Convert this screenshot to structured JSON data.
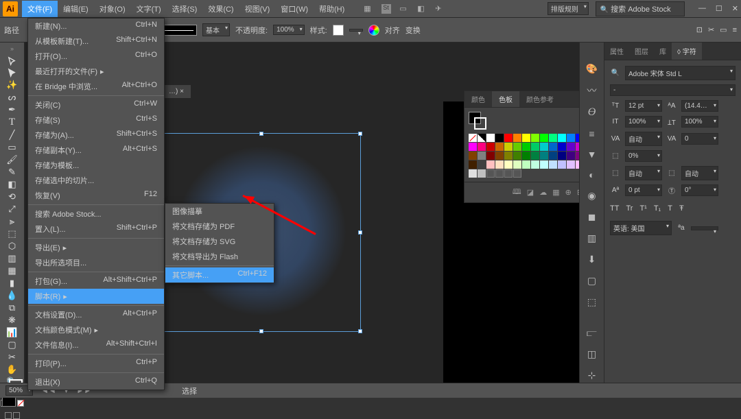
{
  "app": {
    "logo": "Ai"
  },
  "menubar": [
    "文件(F)",
    "编辑(E)",
    "对象(O)",
    "文字(T)",
    "选择(S)",
    "效果(C)",
    "视图(V)",
    "窗口(W)",
    "帮助(H)"
  ],
  "top_right": {
    "layout_label": "排版规则",
    "search_placeholder": "搜索 Adobe Stock"
  },
  "control_bar": {
    "stroke_style": "基本",
    "opacity_label": "不透明度:",
    "opacity_value": "100%",
    "style_label": "样式:",
    "align_label": "对齐",
    "transform_label": "变换"
  },
  "doc_tab": "…)   ×",
  "file_menu": [
    {
      "label": "新建(N)...",
      "shortcut": "Ctrl+N"
    },
    {
      "label": "从模板新建(T)...",
      "shortcut": "Shift+Ctrl+N"
    },
    {
      "label": "打开(O)...",
      "shortcut": "Ctrl+O"
    },
    {
      "label": "最近打开的文件(F)",
      "shortcut": "",
      "sub": true
    },
    {
      "label": "在 Bridge 中浏览...",
      "shortcut": "Alt+Ctrl+O"
    },
    {
      "sep": true
    },
    {
      "label": "关闭(C)",
      "shortcut": "Ctrl+W"
    },
    {
      "label": "存储(S)",
      "shortcut": "Ctrl+S"
    },
    {
      "label": "存储为(A)...",
      "shortcut": "Shift+Ctrl+S"
    },
    {
      "label": "存储副本(Y)...",
      "shortcut": "Alt+Ctrl+S"
    },
    {
      "label": "存储为模板...",
      "shortcut": ""
    },
    {
      "label": "存储选中的切片...",
      "shortcut": ""
    },
    {
      "label": "恢复(V)",
      "shortcut": "F12"
    },
    {
      "sep": true
    },
    {
      "label": "搜索 Adobe Stock...",
      "shortcut": ""
    },
    {
      "label": "置入(L)...",
      "shortcut": "Shift+Ctrl+P"
    },
    {
      "sep": true
    },
    {
      "label": "导出(E)",
      "shortcut": "",
      "sub": true
    },
    {
      "label": "导出所选项目...",
      "shortcut": ""
    },
    {
      "sep": true
    },
    {
      "label": "打包(G)...",
      "shortcut": "Alt+Shift+Ctrl+P"
    },
    {
      "label": "脚本(R)",
      "shortcut": "",
      "sub": true,
      "hl": true
    },
    {
      "sep": true
    },
    {
      "label": "文档设置(D)...",
      "shortcut": "Alt+Ctrl+P"
    },
    {
      "label": "文档颜色模式(M)",
      "shortcut": "",
      "sub": true
    },
    {
      "label": "文件信息(I)...",
      "shortcut": "Alt+Shift+Ctrl+I"
    },
    {
      "sep": true
    },
    {
      "label": "打印(P)...",
      "shortcut": "Ctrl+P"
    },
    {
      "sep": true
    },
    {
      "label": "退出(X)",
      "shortcut": "Ctrl+Q"
    }
  ],
  "script_submenu": [
    {
      "label": "图像描摹",
      "shortcut": ""
    },
    {
      "label": "将文档存储为 PDF",
      "shortcut": ""
    },
    {
      "label": "将文档存储为 SVG",
      "shortcut": ""
    },
    {
      "label": "将文档导出为 Flash",
      "shortcut": ""
    },
    {
      "sep": true
    },
    {
      "label": "其它脚本...",
      "shortcut": "Ctrl+F12",
      "hl": true
    }
  ],
  "swatch_panel": {
    "tabs": [
      "颜色",
      "色板",
      "颜色参考"
    ],
    "active_tab": 1,
    "colors_row1": [
      "#ffffff",
      "#000000",
      "#ff0000",
      "#ff8000",
      "#ffff00",
      "#80ff00",
      "#00ff00",
      "#00ff80",
      "#00ffff",
      "#0080ff",
      "#0000ff",
      "#8000ff",
      "#ff00ff",
      "#ff0080"
    ],
    "colors_row2": [
      "#cc0000",
      "#cc6600",
      "#cccc00",
      "#66cc00",
      "#00cc00",
      "#00cc66",
      "#00cccc",
      "#0066cc",
      "#0000cc",
      "#6600cc",
      "#cc00cc",
      "#cc0066",
      "#804000",
      "#808080"
    ],
    "colors_row3": [
      "#800000",
      "#804000",
      "#808000",
      "#408000",
      "#008000",
      "#008040",
      "#008080",
      "#004080",
      "#000080",
      "#400080",
      "#800080",
      "#800040",
      "#402000",
      "#404040"
    ],
    "colors_row4": [
      "#ffc0c0",
      "#ffe0c0",
      "#ffffc0",
      "#e0ffc0",
      "#c0ffc0",
      "#c0ffe0",
      "#c0ffff",
      "#c0e0ff",
      "#c0c0ff",
      "#e0c0ff",
      "#ffc0ff",
      "#ffc0e0",
      "#e0e0e0",
      "#c0c0c0"
    ]
  },
  "char_panel": {
    "tabs": [
      "属性",
      "图层",
      "库",
      "◊ 字符"
    ],
    "active_tab": 3,
    "font": "Adobe 宋体 Std L",
    "style": "-",
    "size_ic": "ᵀT",
    "size": "12 pt",
    "leading_ic": "ᴬA",
    "leading": "(14.4…",
    "vscale_ic": "IT",
    "vscale": "100%",
    "hscale_ic": "ꞱT",
    "hscale": "100%",
    "kern_ic": "VA",
    "kern": "自动",
    "track_ic": "VA",
    "track": "0",
    "snap_ic": "⬚",
    "snap": "0%",
    "baseline_alt_ic": "⬚",
    "baseline_alt": "自动",
    "baseline_alt2": "自动",
    "baseline_ic": "Aª",
    "baseline": "0 pt",
    "rotate_ic": "Ⓣ",
    "rotate": "0°",
    "tt_row": [
      "TT",
      "Tr",
      "T¹",
      "T₁",
      "T",
      "Ŧ"
    ],
    "lang_label": "英语: 美国",
    "aa_label": "ªa"
  },
  "statusbar": {
    "zoom": "50%",
    "sel_label": "选择"
  },
  "path_label": "路径"
}
